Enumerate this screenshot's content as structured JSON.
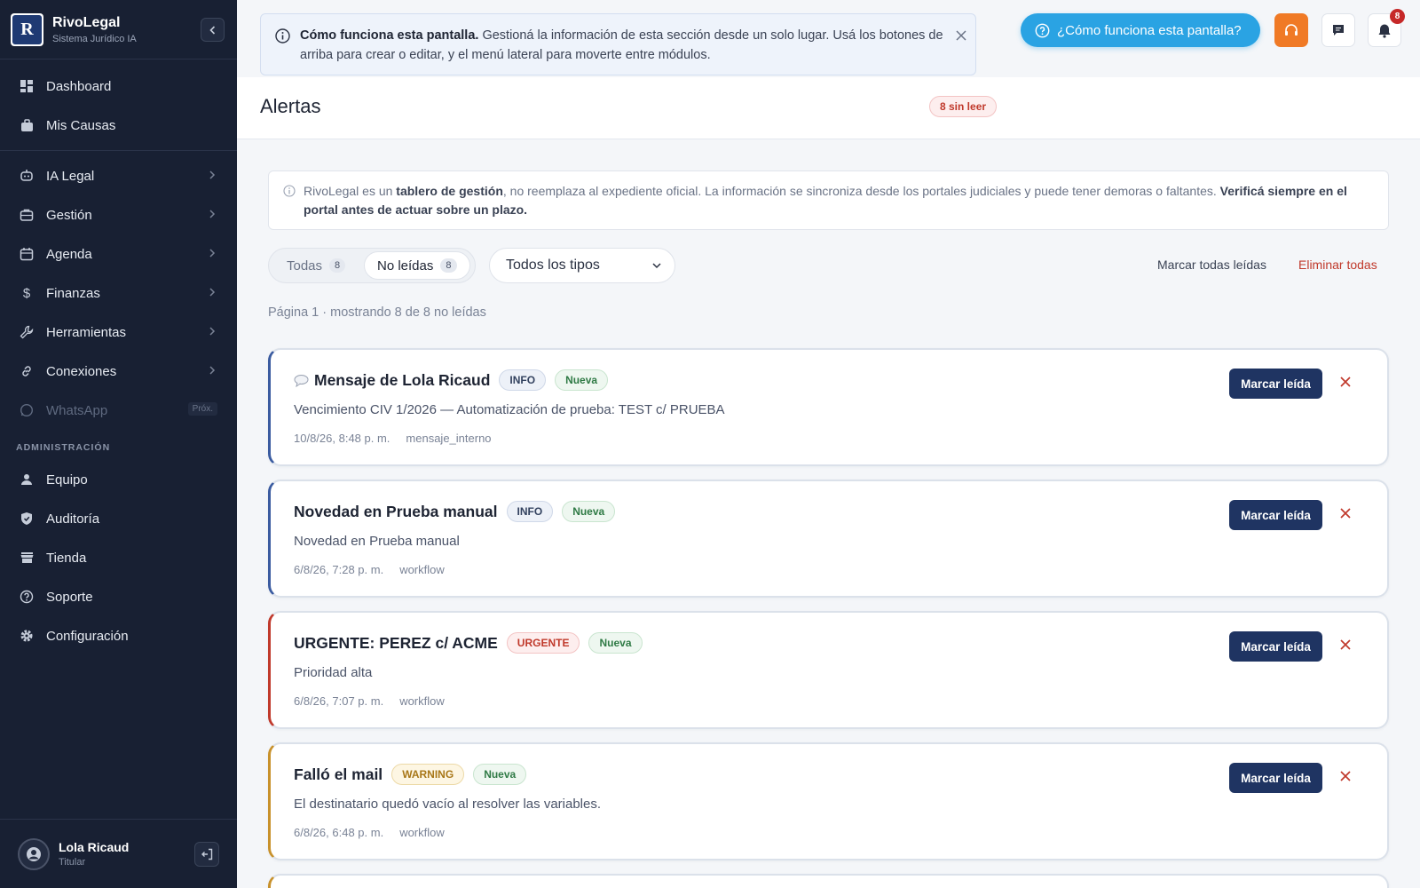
{
  "brand": {
    "name": "RivoLegal",
    "subtitle": "Sistema Jurídico IA",
    "logo_letter": "R"
  },
  "sidebar": {
    "items": [
      {
        "label": "Dashboard",
        "icon": "dashboard-icon"
      },
      {
        "label": "Mis Causas",
        "icon": "briefcase-icon"
      },
      {
        "label": "IA Legal",
        "icon": "robot-icon"
      },
      {
        "label": "Gestión",
        "icon": "folder-icon"
      },
      {
        "label": "Agenda",
        "icon": "calendar-icon"
      },
      {
        "label": "Finanzas",
        "icon": "dollar-icon"
      },
      {
        "label": "Herramientas",
        "icon": "wrench-icon"
      },
      {
        "label": "Conexiones",
        "icon": "link-icon"
      },
      {
        "label": "WhatsApp",
        "icon": "whatsapp-icon",
        "badge": "Próx."
      }
    ],
    "admin_title": "ADMINISTRACIÓN",
    "admin_items": [
      {
        "label": "Equipo",
        "icon": "user-icon"
      },
      {
        "label": "Auditoría",
        "icon": "shield-icon"
      },
      {
        "label": "Tienda",
        "icon": "store-icon"
      },
      {
        "label": "Soporte",
        "icon": "help-icon"
      },
      {
        "label": "Configuración",
        "icon": "gear-icon"
      }
    ],
    "user": {
      "name": "Lola Ricaud",
      "role": "Titular"
    }
  },
  "help_banner": {
    "bold": "Cómo funciona esta pantalla.",
    "text": " Gestioná la información de esta sección desde un solo lugar. Usá los botones de arriba para crear o editar, y el menú lateral para moverte entre módulos."
  },
  "topbar": {
    "help_label": "¿Cómo funciona esta pantalla?",
    "notification_count": "8"
  },
  "header": {
    "title": "Alertas",
    "unread_badge": "8 sin leer"
  },
  "disclaimer": {
    "part1": "RivoLegal es un ",
    "bold1": "tablero de gestión",
    "part2": ", no reemplaza al expediente oficial. La información se sincroniza desde los portales judiciales y puede tener demoras o faltantes. ",
    "bold2": "Verificá siempre en el portal antes de actuar sobre un plazo."
  },
  "filters": {
    "all_label": "Todas",
    "all_count": "8",
    "unread_label": "No leídas",
    "unread_count": "8",
    "type_select": "Todos los tipos",
    "mark_all": "Marcar todas leídas",
    "delete_all": "Eliminar todas"
  },
  "page_info": "Página 1 · mostrando 8 de 8 no leídas",
  "alerts": [
    {
      "title": "Mensaje de Lola Ricaud",
      "level": "INFO",
      "status": "Nueva",
      "desc": "Vencimiento CIV 1/2026 — Automatización de prueba: TEST c/ PRUEBA",
      "date": "10/8/26, 8:48 p. m.",
      "source": "mensaje_interno",
      "action": "Marcar leída"
    },
    {
      "title": "Novedad en Prueba manual",
      "level": "INFO",
      "status": "Nueva",
      "desc": "Novedad en Prueba manual",
      "date": "6/8/26, 7:28 p. m.",
      "source": "workflow",
      "action": "Marcar leída"
    },
    {
      "title": "URGENTE: PEREZ c/ ACME",
      "level": "URGENTE",
      "status": "Nueva",
      "desc": "Prioridad alta",
      "date": "6/8/26, 7:07 p. m.",
      "source": "workflow",
      "action": "Marcar leída"
    },
    {
      "title": "Falló el mail",
      "level": "WARNING",
      "status": "Nueva",
      "desc": "El destinatario quedó vacío al resolver las variables.",
      "date": "6/8/26, 6:48 p. m.",
      "source": "workflow",
      "action": "Marcar leída"
    }
  ],
  "colors": {
    "sidebar_bg": "#182033",
    "primary": "#1f3462",
    "accent": "#2aa3e3",
    "support": "#f07a26",
    "danger": "#c0392b",
    "warning": "#c8912b"
  }
}
